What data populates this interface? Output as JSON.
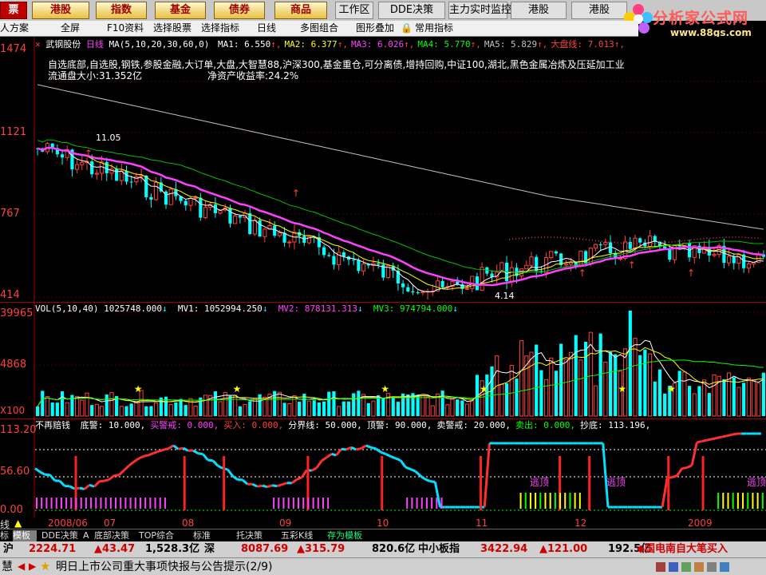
{
  "topbar": {
    "items": [
      {
        "label": "票",
        "style": "dark"
      },
      {
        "label": "港股",
        "style": "brand"
      },
      {
        "label": "指数",
        "style": "brand"
      },
      {
        "label": "基金",
        "style": "brand"
      },
      {
        "label": "债券",
        "style": "brand"
      },
      {
        "label": "商品",
        "style": "brand"
      },
      {
        "label": "工作区",
        "style": "plain"
      },
      {
        "label": "DDE决策",
        "style": "plain"
      },
      {
        "label": "主力实时监控",
        "style": "plain"
      },
      {
        "label": "港股",
        "style": "plain"
      },
      {
        "label": "港股",
        "style": "plain"
      }
    ],
    "logo_text": "分析家公式网",
    "logo_url": "www.88gs.com"
  },
  "toolbar": {
    "items": [
      "人方案",
      "全屏",
      "F10资料",
      "选择股票",
      "选择指标",
      "日线",
      "多图组合",
      "图形叠加",
      "常用指标"
    ]
  },
  "price": {
    "stock_name": "武钢股份",
    "period": "日线",
    "ma_params": "MA(5,10,20,30,60,0)",
    "ma_values": [
      {
        "label": "MA1: 6.550",
        "color": "#ffffff"
      },
      {
        "label": "MA2: 6.377",
        "color": "#ffff00"
      },
      {
        "label": "MA3: 6.026",
        "color": "#ff40ff"
      },
      {
        "label": "MA4: 5.770",
        "color": "#00ff00"
      },
      {
        "label": "MA5: 5.829",
        "color": "#c0c0c0"
      },
      {
        "label": "大盘线: 7.013",
        "color": "#ff4040"
      }
    ],
    "concepts": "自选底部,自选股,钢铁,参股金融,大订单,大盘,大智慧88,沪深300,基金重仓,可分离债,增持回购,中证100,湖北,黑色金属冶炼及压延加工业",
    "float_cap": "流通盘大小:31.352亿",
    "roe": "净资产收益率:24.2%",
    "axis_labels": [
      "1474",
      "1121",
      "767",
      "414"
    ],
    "annotations": [
      "11.05",
      "4.14"
    ],
    "colors": {
      "up": "#ff4040",
      "down": "#00ffff",
      "ma5": "#ffffff",
      "ma10": "#ffff00",
      "ma20": "#ff40ff",
      "ma30": "#00c000",
      "ma60": "#c0c0c0",
      "dapan": "#ff3060"
    }
  },
  "volume": {
    "header_params": "VOL(5,10,40)",
    "vol": "1025748.000",
    "mv1": "MV1: 1052994.250",
    "mv2": "MV2: 878131.313",
    "mv3": "MV3: 974794.000",
    "axis_labels": [
      "39965",
      "4868",
      "X100"
    ]
  },
  "indicator": {
    "name": "不再赔钱",
    "params": [
      {
        "label": "底警: 10.000",
        "color": "#ffffff"
      },
      {
        "label": "买警戒: 0.000",
        "color": "#ff40ff"
      },
      {
        "label": "买入: 0.000",
        "color": "#ff4040"
      },
      {
        "label": "分界线: 50.000",
        "color": "#ffffff"
      },
      {
        "label": "顶警: 90.000",
        "color": "#ffffff"
      },
      {
        "label": "卖警戒: 20.000",
        "color": "#ffffff"
      },
      {
        "label": "卖出: 0.000",
        "color": "#00ff00"
      },
      {
        "label": "抄底: 113.196",
        "color": "#ffffff"
      }
    ],
    "axis_labels": [
      "113.20",
      "56.60",
      "0.00"
    ],
    "tags": [
      "逃顶",
      "逃顶",
      "逃顶"
    ]
  },
  "date_axis": {
    "labels": [
      "2008/06",
      "07",
      "08",
      "09",
      "10",
      "11",
      "12",
      "2009"
    ]
  },
  "tabs": {
    "items": [
      "标",
      "模板",
      "DDE决策",
      "A",
      "底部决策",
      "TOP综合",
      "标准",
      "托决策",
      "五彩K线",
      "存为模板"
    ],
    "active_index": 1
  },
  "ticker": {
    "index_value": "2224.71",
    "index_change": "▲43.47",
    "index_amount": "1,528.3亿",
    "market2": "深",
    "sz_value": "8087.69",
    "sz_change": "▲315.79",
    "sz_amount": "820.6亿",
    "board": "中小板指",
    "board_value": "3422.94",
    "board_change": "▲121.00",
    "board_amount": "192.5亿",
    "news_label": "◆国电南自大笔买入"
  },
  "marquee": {
    "prefix": "慧",
    "message": "明日上市公司重大事项快报与公告提示(2/9)"
  }
}
